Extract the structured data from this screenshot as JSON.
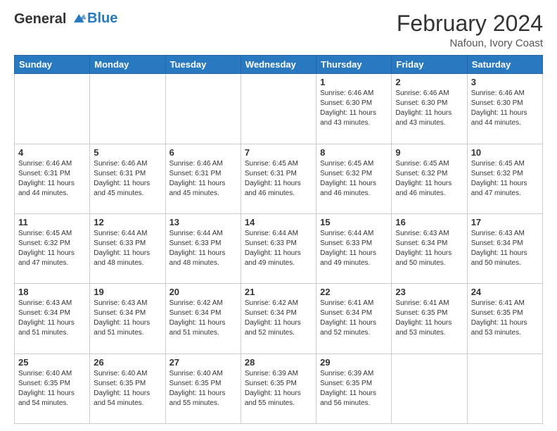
{
  "header": {
    "logo_line1": "General",
    "logo_line2": "Blue",
    "title": "February 2024",
    "subtitle": "Nafoun, Ivory Coast"
  },
  "days_of_week": [
    "Sunday",
    "Monday",
    "Tuesday",
    "Wednesday",
    "Thursday",
    "Friday",
    "Saturday"
  ],
  "weeks": [
    [
      {
        "day": "",
        "info": ""
      },
      {
        "day": "",
        "info": ""
      },
      {
        "day": "",
        "info": ""
      },
      {
        "day": "",
        "info": ""
      },
      {
        "day": "1",
        "info": "Sunrise: 6:46 AM\nSunset: 6:30 PM\nDaylight: 11 hours\nand 43 minutes."
      },
      {
        "day": "2",
        "info": "Sunrise: 6:46 AM\nSunset: 6:30 PM\nDaylight: 11 hours\nand 43 minutes."
      },
      {
        "day": "3",
        "info": "Sunrise: 6:46 AM\nSunset: 6:30 PM\nDaylight: 11 hours\nand 44 minutes."
      }
    ],
    [
      {
        "day": "4",
        "info": "Sunrise: 6:46 AM\nSunset: 6:31 PM\nDaylight: 11 hours\nand 44 minutes."
      },
      {
        "day": "5",
        "info": "Sunrise: 6:46 AM\nSunset: 6:31 PM\nDaylight: 11 hours\nand 45 minutes."
      },
      {
        "day": "6",
        "info": "Sunrise: 6:46 AM\nSunset: 6:31 PM\nDaylight: 11 hours\nand 45 minutes."
      },
      {
        "day": "7",
        "info": "Sunrise: 6:45 AM\nSunset: 6:31 PM\nDaylight: 11 hours\nand 46 minutes."
      },
      {
        "day": "8",
        "info": "Sunrise: 6:45 AM\nSunset: 6:32 PM\nDaylight: 11 hours\nand 46 minutes."
      },
      {
        "day": "9",
        "info": "Sunrise: 6:45 AM\nSunset: 6:32 PM\nDaylight: 11 hours\nand 46 minutes."
      },
      {
        "day": "10",
        "info": "Sunrise: 6:45 AM\nSunset: 6:32 PM\nDaylight: 11 hours\nand 47 minutes."
      }
    ],
    [
      {
        "day": "11",
        "info": "Sunrise: 6:45 AM\nSunset: 6:32 PM\nDaylight: 11 hours\nand 47 minutes."
      },
      {
        "day": "12",
        "info": "Sunrise: 6:44 AM\nSunset: 6:33 PM\nDaylight: 11 hours\nand 48 minutes."
      },
      {
        "day": "13",
        "info": "Sunrise: 6:44 AM\nSunset: 6:33 PM\nDaylight: 11 hours\nand 48 minutes."
      },
      {
        "day": "14",
        "info": "Sunrise: 6:44 AM\nSunset: 6:33 PM\nDaylight: 11 hours\nand 49 minutes."
      },
      {
        "day": "15",
        "info": "Sunrise: 6:44 AM\nSunset: 6:33 PM\nDaylight: 11 hours\nand 49 minutes."
      },
      {
        "day": "16",
        "info": "Sunrise: 6:43 AM\nSunset: 6:34 PM\nDaylight: 11 hours\nand 50 minutes."
      },
      {
        "day": "17",
        "info": "Sunrise: 6:43 AM\nSunset: 6:34 PM\nDaylight: 11 hours\nand 50 minutes."
      }
    ],
    [
      {
        "day": "18",
        "info": "Sunrise: 6:43 AM\nSunset: 6:34 PM\nDaylight: 11 hours\nand 51 minutes."
      },
      {
        "day": "19",
        "info": "Sunrise: 6:43 AM\nSunset: 6:34 PM\nDaylight: 11 hours\nand 51 minutes."
      },
      {
        "day": "20",
        "info": "Sunrise: 6:42 AM\nSunset: 6:34 PM\nDaylight: 11 hours\nand 51 minutes."
      },
      {
        "day": "21",
        "info": "Sunrise: 6:42 AM\nSunset: 6:34 PM\nDaylight: 11 hours\nand 52 minutes."
      },
      {
        "day": "22",
        "info": "Sunrise: 6:41 AM\nSunset: 6:34 PM\nDaylight: 11 hours\nand 52 minutes."
      },
      {
        "day": "23",
        "info": "Sunrise: 6:41 AM\nSunset: 6:35 PM\nDaylight: 11 hours\nand 53 minutes."
      },
      {
        "day": "24",
        "info": "Sunrise: 6:41 AM\nSunset: 6:35 PM\nDaylight: 11 hours\nand 53 minutes."
      }
    ],
    [
      {
        "day": "25",
        "info": "Sunrise: 6:40 AM\nSunset: 6:35 PM\nDaylight: 11 hours\nand 54 minutes."
      },
      {
        "day": "26",
        "info": "Sunrise: 6:40 AM\nSunset: 6:35 PM\nDaylight: 11 hours\nand 54 minutes."
      },
      {
        "day": "27",
        "info": "Sunrise: 6:40 AM\nSunset: 6:35 PM\nDaylight: 11 hours\nand 55 minutes."
      },
      {
        "day": "28",
        "info": "Sunrise: 6:39 AM\nSunset: 6:35 PM\nDaylight: 11 hours\nand 55 minutes."
      },
      {
        "day": "29",
        "info": "Sunrise: 6:39 AM\nSunset: 6:35 PM\nDaylight: 11 hours\nand 56 minutes."
      },
      {
        "day": "",
        "info": ""
      },
      {
        "day": "",
        "info": ""
      }
    ]
  ]
}
